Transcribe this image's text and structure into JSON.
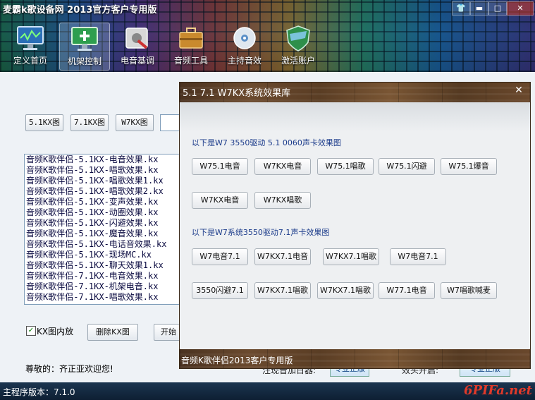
{
  "window": {
    "title": "麦霸k歌设备网 2013官方客户专用版",
    "controls": {
      "shirt": "👕",
      "minimize": "▬",
      "maximize": "□",
      "close": "✕"
    }
  },
  "nav": [
    {
      "label": "定义首页",
      "icon": "monitor-icon",
      "active": false
    },
    {
      "label": "机架控制",
      "icon": "monitor-plus-icon",
      "active": true
    },
    {
      "label": "电音基调",
      "icon": "tools-icon",
      "active": false
    },
    {
      "label": "音频工具",
      "icon": "toolbox-icon",
      "active": false
    },
    {
      "label": "主持音效",
      "icon": "disc-icon",
      "active": false
    },
    {
      "label": "激活账户",
      "icon": "shield-icon",
      "active": false
    }
  ],
  "main": {
    "kx_buttons": [
      "5.1KX图",
      "7.1KX图",
      "W7KX图"
    ],
    "kx_list": [
      "音频K歌伴侣-5.1KX-电音效果.kx",
      "音频K歌伴侣-5.1KX-唱歌效果.kx",
      "音频K歌伴侣-5.1KX-唱歌效果1.kx",
      "音频K歌伴侣-5.1KX-唱歌效果2.kx",
      "音频K歌伴侣-5.1KX-变声效果.kx",
      "音频K歌伴侣-5.1KX-动圈效果.kx",
      "音频K歌伴侣-5.1KX-闪避效果.kx",
      "音频K歌伴侣-5.1KX-魔音效果.kx",
      "音频K歌伴侣-5.1KX-电话音效果.kx",
      "音频K歌伴侣-5.1KX-现场MC.kx",
      "音频K歌伴侣-5.1KX-聊天效果1.kx",
      "音频K歌伴侣-7.1KX-电音效果.kx",
      "音频K歌伴侣-7.1KX-机架电音.kx",
      "音频K歌伴侣-7.1KX-唱歌效果.kx"
    ],
    "checkbox_label": "KX图内放",
    "checkbox_checked": true,
    "delete_button": "删除KX图",
    "start_button": "开始",
    "welcome": "尊敬的：齐正亚欢迎您!",
    "partial_text_a": "汪现音加日器:",
    "partial_text_b": "效头开启:",
    "partial_button_a": "专业正版",
    "partial_button_b": "专业正版"
  },
  "dialog": {
    "title": "5.1 7.1 W7KX系统效果库",
    "close": "✕",
    "section1": "以下是W7 3550驱动 5.1 0060声卡效果图",
    "section1_buttons": [
      "W75.1电音",
      "W7KX电音",
      "W75.1唱歌",
      "W75.1闪避",
      "W75.1爆音",
      "W7KX电音",
      "W7KX唱歌"
    ],
    "section2": "以下是W7系统3550驱动7.1声卡效果图",
    "section2_buttons": [
      "W7电音7.1",
      "W7KX7.1电音",
      "W7KX7.1唱歌",
      "W7电音7.1",
      "3550闪避7.1",
      "W7KX7.1唱歌",
      "W7KX7.1唱歌",
      "W77.1电音",
      "W7唱歌喊麦"
    ],
    "footer": "音频K歌伴侣2013客户专用版"
  },
  "status": {
    "version": "主程序版本：7.1.0",
    "brand": "6PIFa.net"
  },
  "colors": {
    "title_bar": "#123a5c",
    "section_text": "#1a3a8a",
    "brand_red": "#e23a2a"
  }
}
